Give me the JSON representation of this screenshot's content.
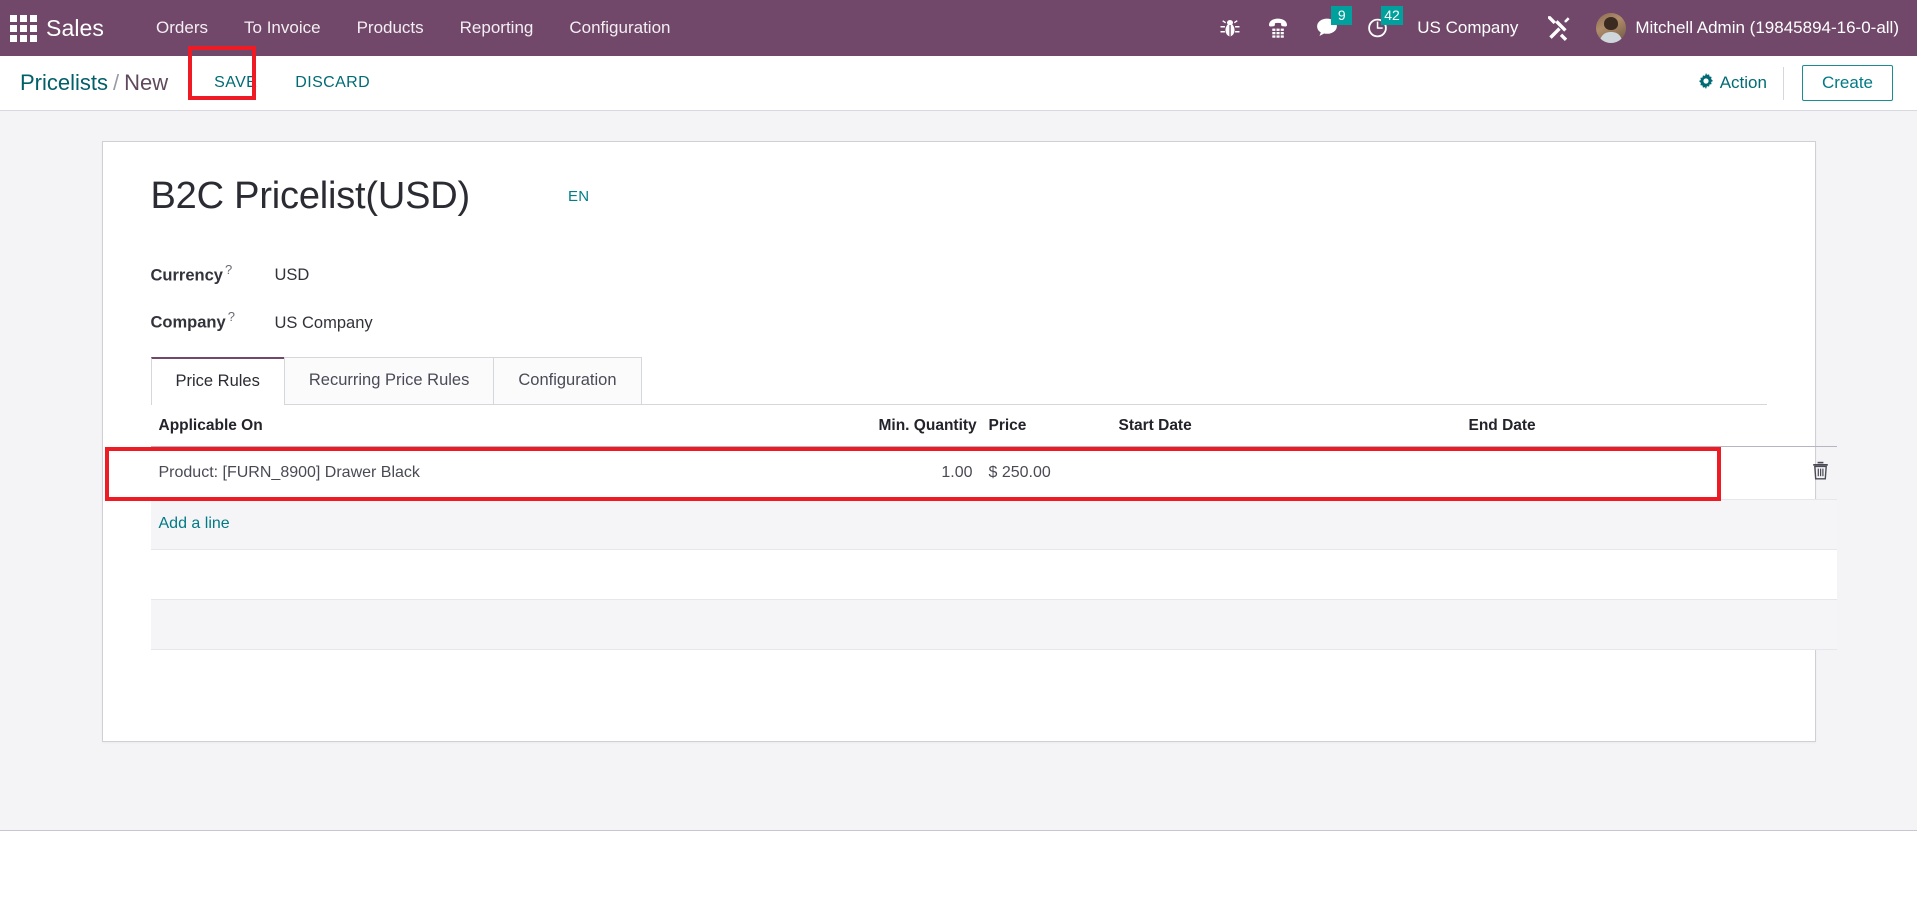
{
  "navbar": {
    "apps_icon": "apps-grid-icon",
    "brand": "Sales",
    "menu": [
      {
        "label": "Orders"
      },
      {
        "label": "To Invoice"
      },
      {
        "label": "Products"
      },
      {
        "label": "Reporting"
      },
      {
        "label": "Configuration"
      }
    ],
    "icons": [
      {
        "name": "bug-icon"
      },
      {
        "name": "phone-dialpad-icon"
      },
      {
        "name": "messages-icon",
        "badge": "9"
      },
      {
        "name": "activities-clock-icon",
        "badge": "42"
      }
    ],
    "company": "US Company",
    "tools_icon": "tools-icon",
    "user_name": "Mitchell Admin (19845894-16-0-all)",
    "accent_badge_color": "#00a09d",
    "background_color": "#71476a"
  },
  "control_panel": {
    "breadcrumb_root": "Pricelists",
    "breadcrumb_separator": "/",
    "breadcrumb_current": "New",
    "save_label": "SAVE",
    "discard_label": "DISCARD",
    "action_label": "Action",
    "create_label": "Create",
    "highlight_color": "#ee1b24"
  },
  "record": {
    "title": "B2C Pricelist(USD)",
    "language_code": "EN",
    "fields": [
      {
        "label": "Currency",
        "help": "?",
        "value": "USD"
      },
      {
        "label": "Company",
        "help": "?",
        "value": "US Company"
      }
    ]
  },
  "notebook": {
    "tabs": [
      {
        "label": "Price Rules",
        "active": true
      },
      {
        "label": "Recurring Price Rules",
        "active": false
      },
      {
        "label": "Configuration",
        "active": false
      }
    ]
  },
  "price_rules": {
    "columns": [
      "Applicable On",
      "Min. Quantity",
      "Price",
      "Start Date",
      "End Date"
    ],
    "rows": [
      {
        "applicable_on": "Product: [FURN_8900] Drawer Black",
        "min_quantity": "1.00",
        "price": "$ 250.00",
        "start_date": "",
        "end_date": "",
        "delete_icon": "trash-icon"
      }
    ],
    "add_line_label": "Add a line"
  }
}
